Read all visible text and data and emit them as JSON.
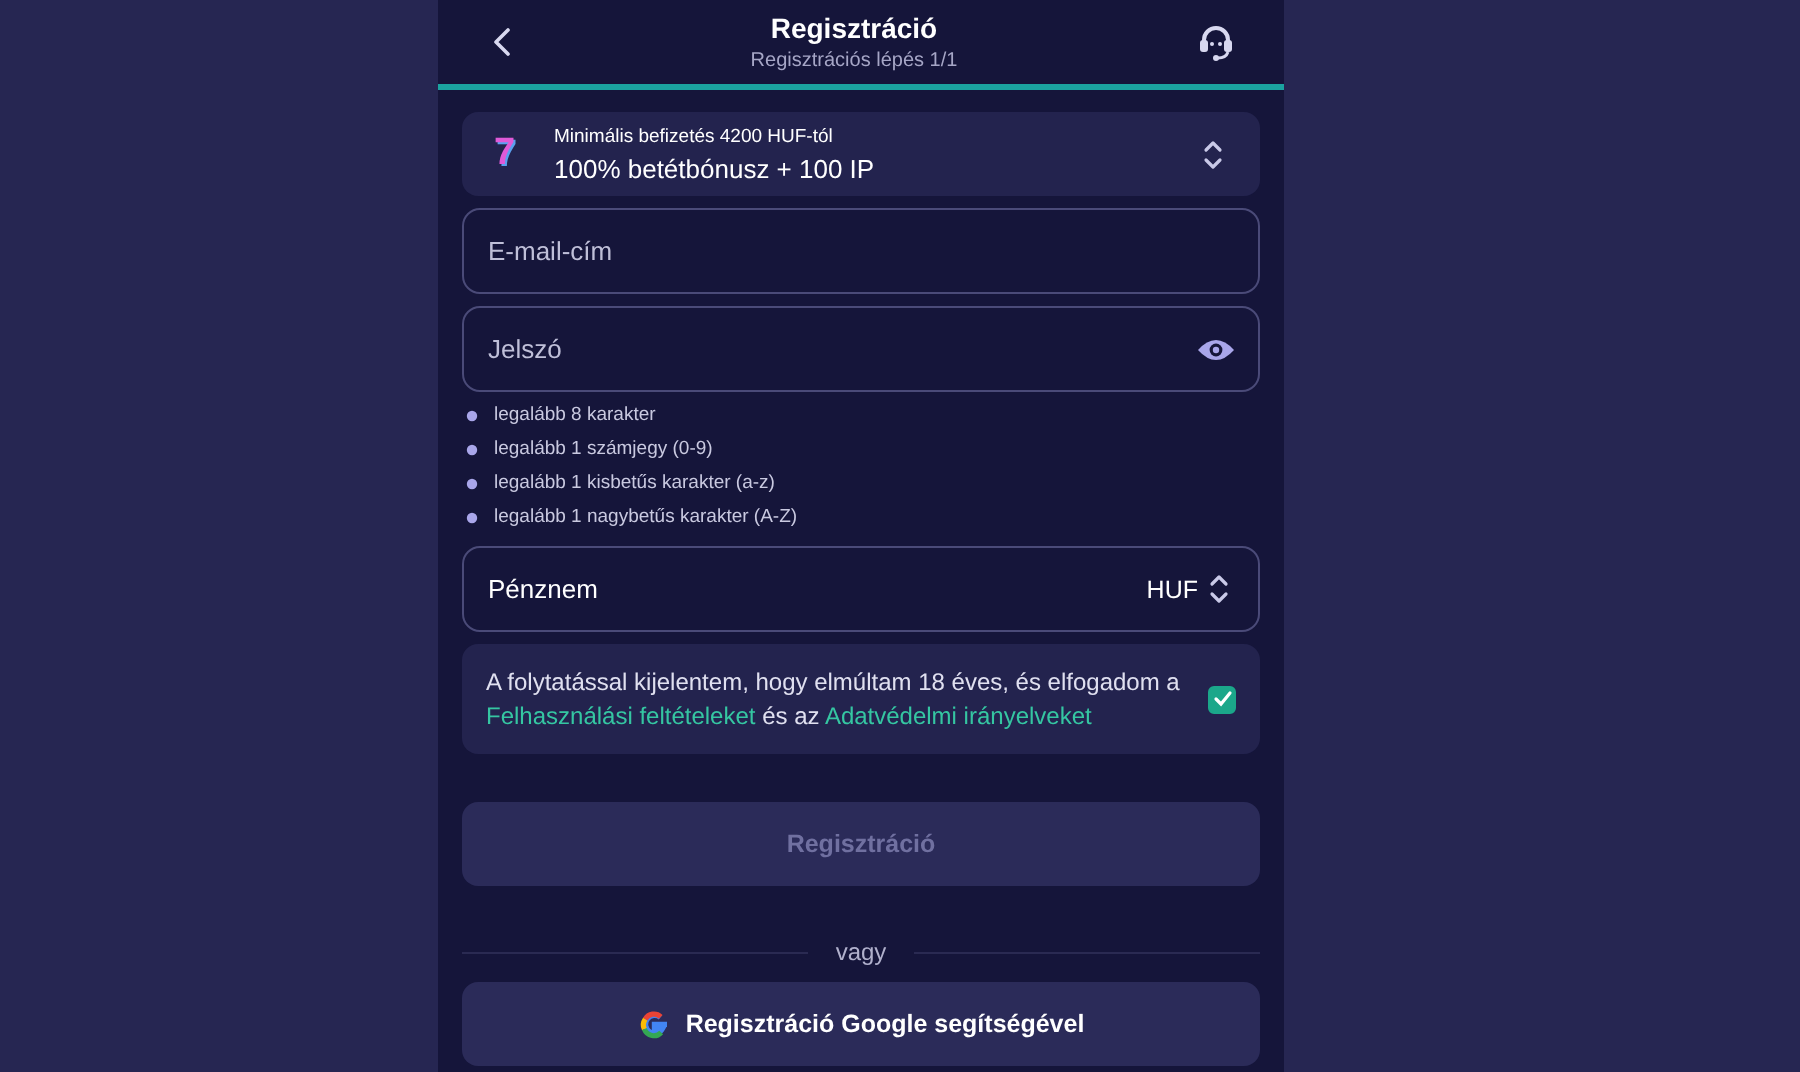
{
  "header": {
    "title": "Regisztráció",
    "subtitle": "Regisztrációs lépés 1/1",
    "progress": {
      "level": 1
    }
  },
  "promo": {
    "badge": "7",
    "caption": "Minimális befizetés 4200 HUF-tól",
    "offer": "100% betétbónusz + 100 IP"
  },
  "email": {
    "placeholder": "E-mail-cím"
  },
  "password": {
    "placeholder": "Jelszó"
  },
  "rules": [
    {
      "text": "legalább 8 karakter"
    },
    {
      "text": "legalább 1 számjegy (0-9)"
    },
    {
      "text": "legalább 1 kisbetűs karakter (a-z)"
    },
    {
      "text": "legalább 1 nagybetűs karakter (A-Z)"
    }
  ],
  "currency": {
    "label": "Pénznem",
    "value": "HUF"
  },
  "terms": {
    "checked": true,
    "parts": [
      {
        "kind": "text",
        "text": "A folytatással kijelentem, hogy elmúltam 18 éves, és elfogadom a "
      },
      {
        "kind": "link",
        "text": "Felhasználási feltételeket"
      },
      {
        "kind": "text",
        "text": " és az "
      },
      {
        "kind": "link",
        "text": "Adatvédelmi irányelveket"
      }
    ]
  },
  "submit": {
    "label": "Regisztráció",
    "disabled": true
  },
  "divider": "vagy",
  "google": {
    "label": "Regisztráció Google segítségével"
  }
}
